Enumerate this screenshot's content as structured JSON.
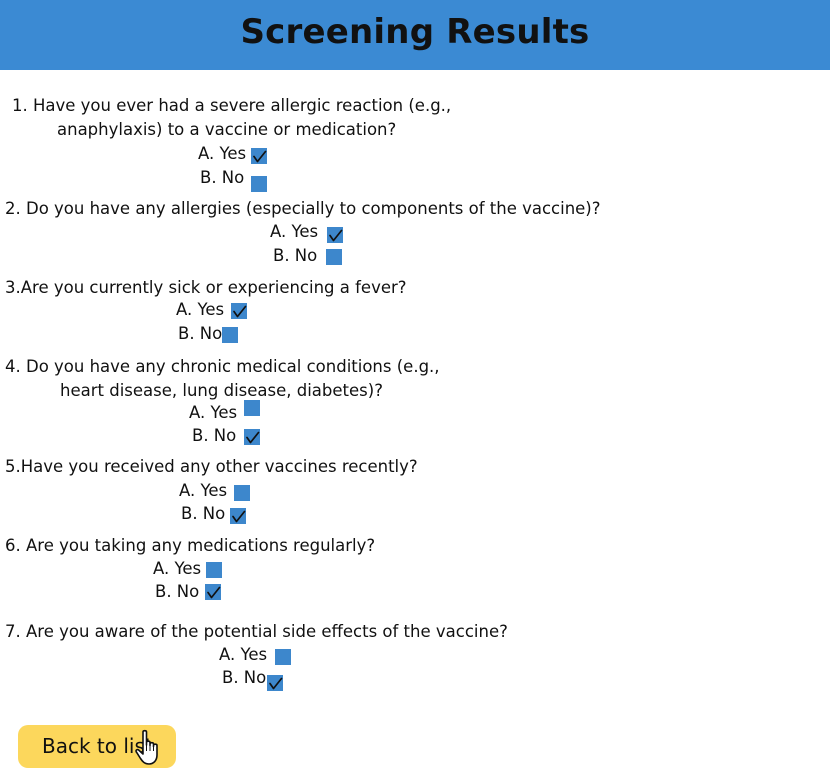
{
  "header": {
    "title": "Screening Results",
    "background_color": "#3b8ad3"
  },
  "checkbox_color": "#3d87cc",
  "questions": [
    {
      "line1": "1. Have you ever had a severe allergic reaction (e.g.,",
      "line2": "anaphylaxis) to a vaccine or medication?",
      "option_a": "A. Yes",
      "option_b": "B. No",
      "a_checked": true,
      "b_checked": false
    },
    {
      "line1": "2. Do you have any allergies (especially to components of the vaccine)?",
      "option_a": "A. Yes",
      "option_b": "B. No",
      "a_checked": true,
      "b_checked": false
    },
    {
      "line1": "3.Are you currently sick or experiencing a fever?",
      "option_a": "A. Yes",
      "option_b": "B. No",
      "a_checked": true,
      "b_checked": false
    },
    {
      "line1": "4. Do you have any chronic medical conditions (e.g.,",
      "line2": "heart disease, lung disease, diabetes)?",
      "option_a": "A. Yes",
      "option_b": "B. No",
      "a_checked": false,
      "b_checked": true
    },
    {
      "line1": "5.Have you received any other vaccines recently?",
      "option_a": "A. Yes",
      "option_b": "B. No",
      "a_checked": false,
      "b_checked": true
    },
    {
      "line1": "6. Are you taking any medications regularly?",
      "option_a": "A. Yes",
      "option_b": "B. No",
      "a_checked": false,
      "b_checked": true
    },
    {
      "line1": "7. Are you aware of the potential side effects of the vaccine?",
      "option_a": "A. Yes",
      "option_b": "B. No",
      "a_checked": false,
      "b_checked": true
    }
  ],
  "back_button": {
    "label": "Back to list",
    "color": "#fcd75c"
  },
  "icons": {
    "check": "checkmark-icon",
    "pointer": "hand-pointer-icon"
  }
}
